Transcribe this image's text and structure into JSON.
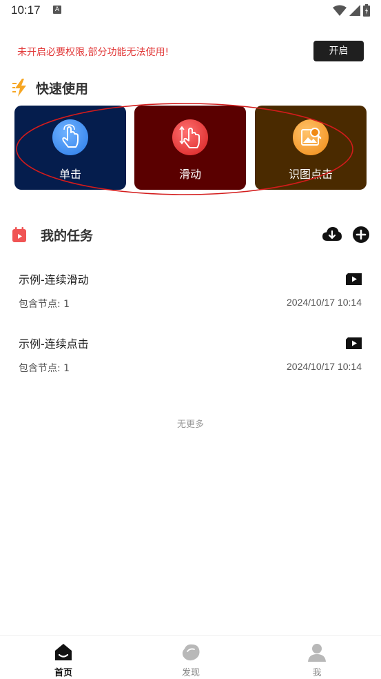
{
  "status_bar": {
    "time": "10:17",
    "notification_letter": "A"
  },
  "permission_banner": {
    "message": "未开启必要权限,部分功能无法使用!",
    "button_label": "开启",
    "message_color": "#e23b3b"
  },
  "quick_use": {
    "title": "快速使用",
    "icon": "lightning-icon",
    "cards": [
      {
        "label": "单击",
        "icon": "tap-hand-icon",
        "bg": "#051d4d"
      },
      {
        "label": "滑动",
        "icon": "swipe-hand-icon",
        "bg": "#5a0000"
      },
      {
        "label": "识图点击",
        "icon": "image-search-icon",
        "bg": "#4a2a00"
      }
    ]
  },
  "my_tasks": {
    "title": "我的任务",
    "icon": "calendar-icon",
    "actions": [
      "cloud-download-icon",
      "add-circle-icon"
    ],
    "items": [
      {
        "name": "示例-连续滑动",
        "nodes": "包含节点: 1",
        "date": "2024/10/17 10:14"
      },
      {
        "name": "示例-连续点击",
        "nodes": "包含节点: 1",
        "date": "2024/10/17 10:14"
      }
    ],
    "end_text": "无更多"
  },
  "bottom_nav": {
    "items": [
      {
        "label": "首页",
        "icon": "home-icon",
        "active": true
      },
      {
        "label": "发现",
        "icon": "discover-icon",
        "active": false
      },
      {
        "label": "我",
        "icon": "person-icon",
        "active": false
      }
    ]
  }
}
